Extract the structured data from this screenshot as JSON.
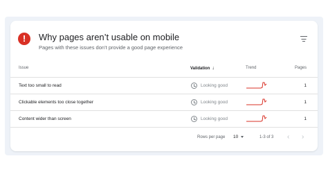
{
  "card": {
    "title": "Why pages aren’t usable on mobile",
    "subtitle": "Pages with these issues don’t provide a good page experience",
    "status_color": "#d93025"
  },
  "table": {
    "columns": {
      "issue": "Issue",
      "validation": "Validation",
      "trend": "Trend",
      "pages": "Pages"
    },
    "sort": {
      "column": "validation",
      "direction": "descending"
    },
    "rows": [
      {
        "issue": "Text too small to read",
        "validation": "Looking good",
        "pages": "1"
      },
      {
        "issue": "Clickable elements too close together",
        "validation": "Looking good",
        "pages": "1"
      },
      {
        "issue": "Content wider than screen",
        "validation": "Looking good",
        "pages": "1"
      }
    ],
    "trend_color": "#d93025"
  },
  "footer": {
    "rows_per_page_label": "Rows per page",
    "rows_per_page_value": "10",
    "range_text": "1-3 of 3"
  }
}
